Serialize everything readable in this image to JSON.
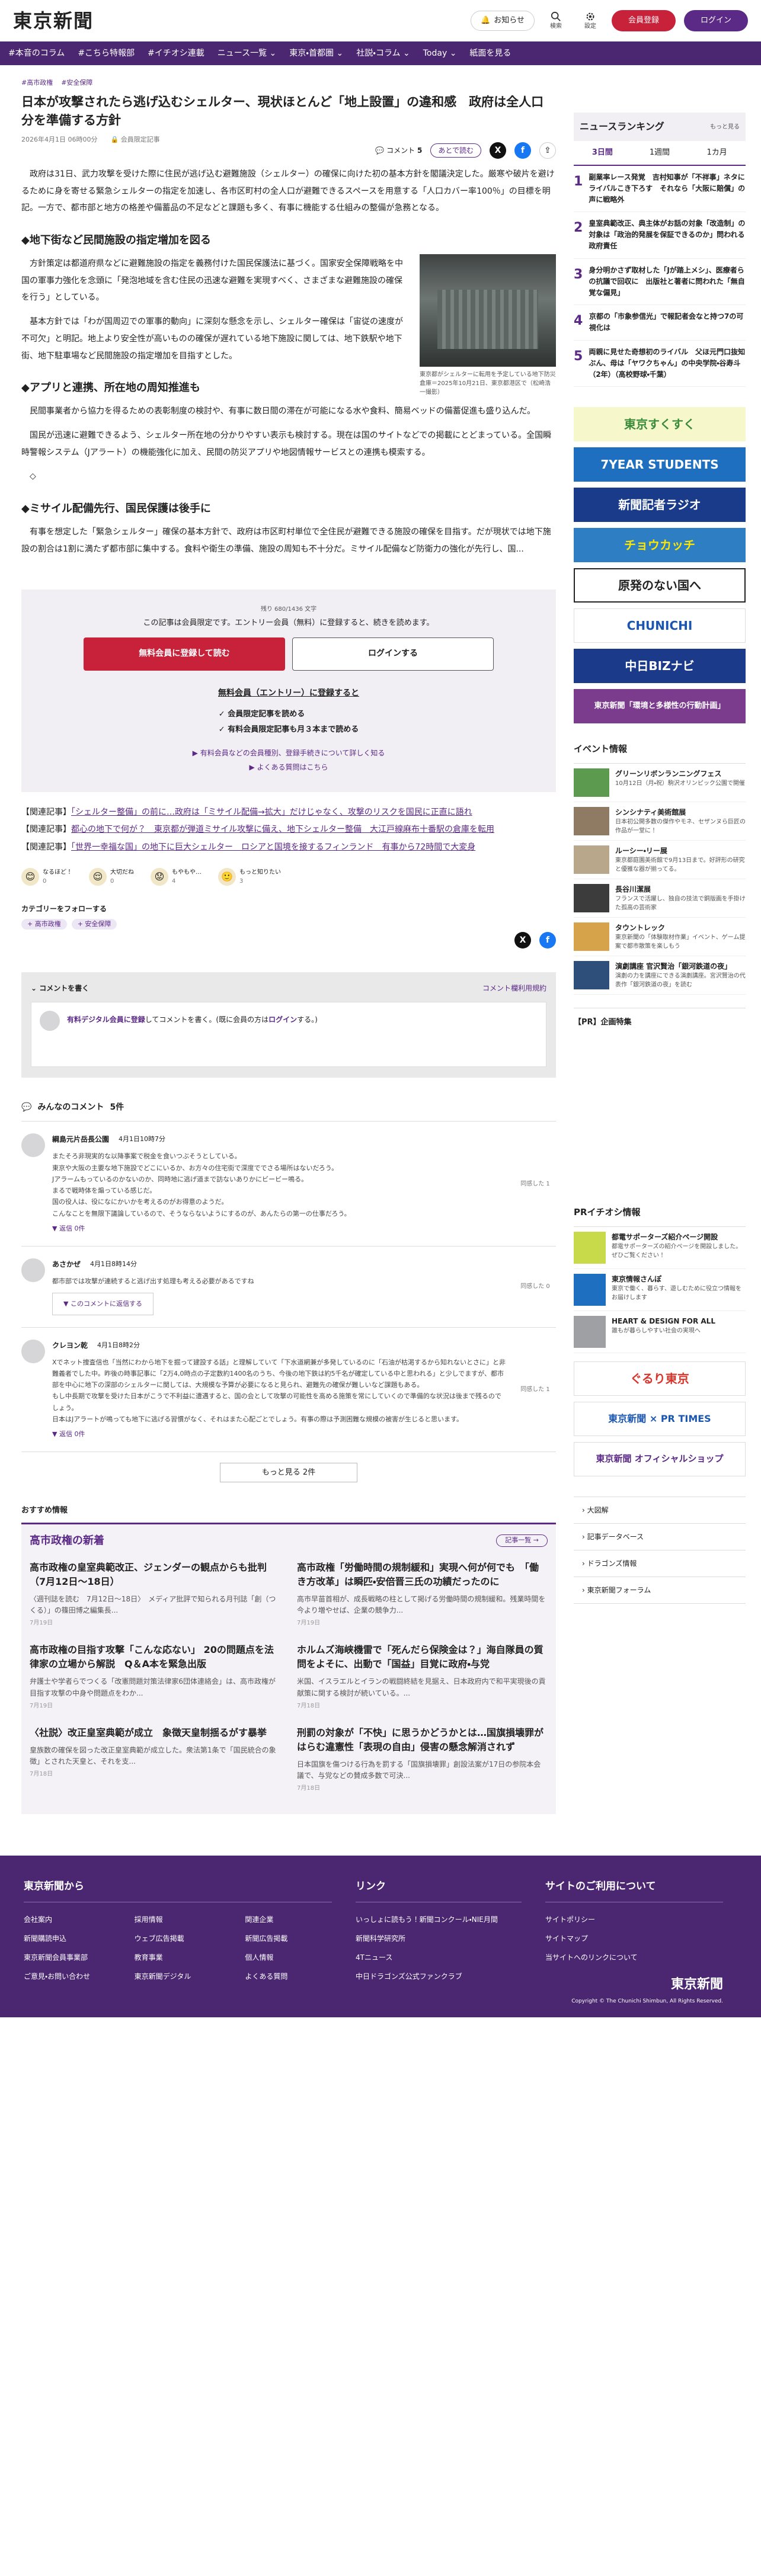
{
  "header": {
    "logo": "東京新聞",
    "notify": "お知らせ",
    "search": "検索",
    "settings": "設定",
    "register": "会員登録",
    "login": "ログイン"
  },
  "nav": [
    "#本音のコラム",
    "#こちら特報部",
    "#イチオシ連載",
    "ニュース一覧 ⌄",
    "東京・首都圏 ⌄",
    "社説・コラム ⌄",
    "Today ⌄",
    "紙面を見る"
  ],
  "article": {
    "tags": [
      "#高市政権",
      "#安全保障"
    ],
    "title": "日本が攻撃されたら逃げ込むシェルター、現状ほとんど「地上設置」の違和感　政府は全人口分を準備する方針",
    "date": "2026年4月1日 06時00分",
    "badge": "会員限定記事",
    "comment_label": "コメント",
    "comment_count": "5",
    "save": "あとで読む",
    "p1": "政府は31日、武力攻撃を受けた際に住民が逃げ込む避難施設（シェルター）の確保に向けた初の基本方針を閣議決定した。厳寒や破片を避けるために身を寄せる緊急シェルターの指定を加速し、各市区町村の全人口が避難できるスペースを用意する「人口カバー率100％」の目標を明記。一方で、都市部と地方の格差や備蓄品の不足などと課題も多く、有事に機能する仕組みの整備が急務となる。",
    "h2a": "◆地下街など民間施設の指定増加を図る",
    "p2": "方針策定は都道府県などに避難施設の指定を義務付けた国民保護法に基づく。国家安全保障戦略を中国の軍事力強化を念頭に「発泡地域を含む住民の迅速な避難を実現すべく、さまざまな避難施設の確保を行う」としている。",
    "p3": "基本方針では「わが国周辺での軍事的動向」に深刻な懸念を示し、シェルター確保は「宙従の速度が不可欠」と明記。地上より安全性が高いものの確保が遅れている地下施設に関しては、地下鉄駅や地下街、地下駐車場など民間施設の指定増加を目指すとした。",
    "fig_caption": "東京都がシェルターに転用を予定している地下防災倉庫＝2025年10月21日、東京都港区で（松崎浩一撮影）",
    "h2b": "◆アプリと連携、所在地の周知推進も",
    "p4": "民間事業者から協力を得るための表彰制度の検討や、有事に数日間の滞在が可能になる水や食料、簡易ベッドの備蓄促進も盛り込んだ。",
    "p5": "国民が迅速に避難できるよう、シェルター所在地の分かりやすい表示も検討する。現在は国のサイトなどでの掲載にとどまっている。全国瞬時警報システム（Jアラート）の機能強化に加え、民間の防災アプリや地図情報サービスとの連携も模索する。",
    "diamond": "◇",
    "h2c": "◆ミサイル配備先行、国民保護は後手に",
    "p6": "有事を想定した「緊急シェルター」確保の基本方針で、政府は市区町村単位で全住民が避難できる施設の確保を目指す。だが現状では地下施設の割合は1割に満たず都市部に集中する。食料や衛生の準備、施設の周知も不十分だ。ミサイル配備など防衛力の強化が先行し、国..."
  },
  "paywall": {
    "count": "残り 680/1436 文字",
    "message": "この記事は会員限定です。エントリー会員（無料）に登録すると、続きを読めます。",
    "register_btn": "無料会員に登録して読む",
    "login_btn": "ログインする",
    "heading": "無料会員（エントリー）に登録すると",
    "benefits": [
      "✓ 会員限定記事を読める",
      "✓ 有料会員限定記事も月３本まで読める"
    ],
    "link1": "▶ 有料会員などの会員種別、登録手続きについて詳しく知る",
    "link2": "▶ よくある質問はこちら"
  },
  "related": [
    {
      "tag": "【関連記事】",
      "text": "「シェルター整備」の前に…政府は「ミサイル配備→拡大」だけじゃなく、攻撃のリスクを国民に正直に語れ"
    },
    {
      "tag": "【関連記事】",
      "text": "都心の地下で何が？　東京都が弾道ミサイル攻撃に備え、地下シェルター整備　大江戸線麻布十番駅の倉庫を転用"
    },
    {
      "tag": "【関連記事】",
      "text": "「世界一幸福な国」の地下に巨大シェルター　ロシアと国境を接するフィンランド　有事から72時間で大変身"
    }
  ],
  "reactions": [
    {
      "icon": "😊",
      "label": "なるほど！",
      "count": "0"
    },
    {
      "icon": "😌",
      "label": "大切だね",
      "count": "0"
    },
    {
      "icon": "😟",
      "label": "もやもや…",
      "count": "4"
    },
    {
      "icon": "🙂",
      "label": "もっと知りたい",
      "count": "3"
    }
  ],
  "follow": {
    "heading": "カテゴリーをフォローする",
    "chips": [
      "+ 高市政権",
      "+ 安全保障"
    ]
  },
  "comment_box": {
    "title": "コメントを書く",
    "policy": "コメント欄利用規約",
    "prompt_link": "有料デジタル会員に登録",
    "prompt_mid": "してコメントを書く。(既に会員の方は",
    "prompt_login": "ログイン",
    "prompt_end": "する。)"
  },
  "comments_heading": {
    "title": "みんなのコメント",
    "count": "5件"
  },
  "comments": [
    {
      "name": "綱島元片岳長公園",
      "date": "4月1日10時7分",
      "text": "またそろ非現実的な以降事案で税金を食いつぶそうとしている。\n東京や大阪の主要な地下施設でどこにいるか、お方々の住宅街で深度ででさる場所はないだろう。\nJアラームもっているのかないのか、同時地に逃げ道まで訪ないありかにビービー鳴る。\nまるで戦時体を煽っている感じだ。\n国の役人は、役になにかいかを考えるのがお得意のようだ。\nこんなことを無限下議論しているので、そうならないようにするのが、あんたらの第一の仕事だろう。",
      "foot": "▼ 返信 0件",
      "agree": "同感した 1"
    },
    {
      "name": "あさかぜ",
      "date": "4月1日8時14分",
      "text": "都市部では攻撃が連続すると逃げ出す処理も考える必要があるですね",
      "foot": "",
      "agree": "同感した 0",
      "reply": "▼ このコメントに返信する"
    },
    {
      "name": "クレヨン乾",
      "date": "4月1日8時2分",
      "text": "Xでネット捜査信也「当然にわから地下を掘って建設する話」と理解していて「下水道網兼が多発しているのに「石油が枯渇するから知れないとさに」と非難義者でした中。昨後の時事記事に「2万4,0時点の子定数約1400名のうち、今後の地下鉄は約5千名が確定している中と思われる」と少しでますが、都市部を中心に地下の深部のシェルターに関しては、大規模な予算が必要になると見られ、避難先の確保が難しいなど課題もある。\nもし中長期で攻撃を受けた日本がこうで不利益に遭遇すると、国の会として攻撃の可能性を高める施策を常にしていくので準備的な状況は後まで残るのでしょう。\n日本はJアラートが鳴っても地下に逃げる習慣がなく、それはまた心配ごとでしょう。有事の際は予測困難な規模の被害が生じると思います。",
      "foot": "▼ 返信 0件",
      "agree": "同感した 1"
    }
  ],
  "more_btn": "もっと見る 2件",
  "recs": {
    "label": "おすすめ情報",
    "box_title": "高市政権の新着",
    "all": "記事一覧 →",
    "items": [
      {
        "title": "高市政権の皇室典範改正、ジェンダーの観点からも批判（7月12日〜18日）",
        "desc": "〈週刊誌を読む　7月12日〜18日〉　メディア批評で知られる月刊誌「創（つくる）」の篠田博之編集長...",
        "date": "7月19日"
      },
      {
        "title": "高市政権「労働時間の規制緩和」実現へ何が何でも　「働き方改革」は瞬匹・安倍晋三氏の功績だったのに",
        "desc": "高市早苗首相が、成長戦略の柱として掲げる労働時間の規制緩和。残業時間を今より増やせば、企業の競争力...",
        "date": "7月19日"
      },
      {
        "title": "高市政権の目指す攻撃「こんな応ない」 20の問題点を法律家の立場から解説　Q＆A本を緊急出版",
        "desc": "弁護士や学者らでつくる「改憲問題対策法律家6団体連絡会」は、高市政権が目指す攻撃の中身や問題点をわか...",
        "date": "7月19日"
      },
      {
        "title": "ホルムズ海峡機雷で「死んだら保険金は？」海自隊員の質問をよそに、出動で「国益」目覚に政府・与党",
        "desc": "米国、イスラエルとイランの戦闘終結を見据え、日本政府内で和平実現後の貢献策に関する検討が続いている。...",
        "date": "7月18日"
      },
      {
        "title": "〈社説〉改正皇室典範が成立　象徴天皇制揺るがす暴挙",
        "desc": "皇族数の確保を図った改正皇室典範が成立した。衆法第1条で「国民統合の象徴」とされた天皇と、それを支...",
        "date": "7月18日"
      },
      {
        "title": "刑罰の対象が「不快」に思うかどうかとは…国旗損壊罪がはらむ違憲性「表現の自由」侵害の懸念解消されず",
        "desc": "日本国旗を傷つける行為を罰する「国旗損壊罪」創設法案が17日の参院本会議で、与党などの賛成多数で可決...",
        "date": "7月18日"
      }
    ]
  },
  "sidebar": {
    "ranking_title": "ニュースランキング",
    "ranking_more": "もっと見る",
    "tabs": [
      "3日間",
      "1週間",
      "1カ月"
    ],
    "ranks": [
      {
        "no": "1",
        "text": "副業率レース発覚　吉村知事が「不祥事」ネタにライバルこき下ろす　それなら「大阪に賠償」の声に戦略外"
      },
      {
        "no": "2",
        "text": "皇室典範改正、典主体がお話の対象「改造制」の対象は「政治的発展を保証できるのか」問われる政府責任"
      },
      {
        "no": "3",
        "text": "身分明かさず取材した「Jが踏上メシ」、医療者らの抗議で回収に　出版社と著者に問われた「無自覚な偏見」"
      },
      {
        "no": "4",
        "text": "京都の「市象参信光」で報記者会なと持つ7の可視化は"
      },
      {
        "no": "5",
        "text": "両親に見せた奇想初のライバル　父ほ元門口抜知ぶん、母は「ヤワクちゃん」の中央学院・谷寿斗（2年）（高校野球・千葉）"
      }
    ],
    "banners": [
      {
        "text": "東京すくすく",
        "bg": "#f6f8cc",
        "fg": "#3a8a3a"
      },
      {
        "text": "7YEAR STUDENTS",
        "bg": "#1e6fbf",
        "fg": "#fff"
      },
      {
        "text": "新聞記者ラジオ",
        "bg": "#1a3b8a",
        "fg": "#fff"
      },
      {
        "text": "チョウカッチ",
        "bg": "#2d7ec2",
        "fg": "#ffe600"
      },
      {
        "text": "原発のない国へ",
        "bg": "#fff",
        "fg": "#222"
      },
      {
        "text": "CHUNICHI",
        "bg": "#fff",
        "fg": "#1a56b0"
      },
      {
        "text": "中日BIZナビ",
        "bg": "#1c3a8a",
        "fg": "#fff"
      },
      {
        "text": "東京新聞「環境と多様性の行動計画」",
        "bg": "#7c3c8e",
        "fg": "#fff"
      }
    ],
    "events_title": "イベント情報",
    "events": [
      {
        "title": "グリーンリボンランニングフェス",
        "desc": "10月12日（月・祝）駒沢オリンピック公園で開催",
        "color": "#5b9a4f"
      },
      {
        "title": "シンシナティ美術館展",
        "desc": "日本初公開多数の傑作やモネ、セザンヌら巨匠の作品が一堂に！",
        "color": "#8f7a64"
      },
      {
        "title": "ルーシー・リー展",
        "desc": "東京都庭園美術館で9月13日まで。好評形の研究と優雅な器が揃ってる。",
        "color": "#b8a78b"
      },
      {
        "title": "長谷川潔展",
        "desc": "フランスで活躍し、独自の技法で銅版画を手掛けた孤高の芸術家",
        "color": "#3c3c3c"
      },
      {
        "title": "タウントレック",
        "desc": "東京新聞の「体験取材作業」イベント、ゲーム提案で都市散策を楽しもう",
        "color": "#d7a34a"
      },
      {
        "title": "演劇講座 官沢賢治「銀河鉄道の夜」",
        "desc": "演劇の力を講座にできる演劇講座。宮沢賢治の代表作「銀河鉄道の夜」を読む",
        "color": "#2e4f7a"
      }
    ],
    "pr_title": "【PR】企画特集",
    "pri_title": "PRイチオシ情報",
    "pri": [
      {
        "title": "都電サポーターズ紹介ページ開設",
        "desc": "都電サポーターズの紹介ページを開設しました。ぜひご覧ください！",
        "color": "#c8d94a"
      },
      {
        "title": "東京情報さんぽ",
        "desc": "東京で働く、暮らす、遊しむために役立つ情報をお届けします",
        "color": "#1e6fbf"
      },
      {
        "title": "HEART & DESIGN FOR ALL",
        "desc": "誰もが暮らしやすい社会の実現へ",
        "color": "#9ea0a3"
      }
    ],
    "pri_banners": [
      {
        "text": "ぐるり東京",
        "bg": "#fff",
        "fg": "#d9342b"
      },
      {
        "text": "東京新聞 × PR TIMES",
        "bg": "#fff",
        "fg": "#1a56b0"
      },
      {
        "text": "東京新聞 オフィシャルショップ",
        "bg": "#fff",
        "fg": "#5b2a86"
      }
    ],
    "links": [
      "大図解",
      "記事データベース",
      "ドラゴンズ情報",
      "東京新聞フォーラム"
    ]
  },
  "footer": {
    "col1": {
      "title": "東京新聞から",
      "items": [
        "会社案内",
        "採用情報",
        "関連企業",
        "新聞購読申込",
        "ウェブ広告掲載",
        "新聞広告掲載",
        "東京新聞会員事業部",
        "教育事業",
        "個人情報",
        "ご意見・お問い合わせ",
        "東京新聞デジタル",
        "よくある質問"
      ]
    },
    "col2": {
      "title": "リンク",
      "items": [
        "いっしょに読もう！新聞コンクール・NIE月間",
        "新聞科学研究所",
        "4Tニュース",
        "中日ドラゴンズ公式ファンクラブ"
      ]
    },
    "col3": {
      "title": "サイトのご利用について",
      "items": [
        "サイトポリシー",
        "サイトマップ",
        "当サイトへのリンクについて"
      ]
    },
    "logo": "東京新聞",
    "copyright": "Copyright © The Chunichi Shimbun, All Rights Reserved."
  }
}
